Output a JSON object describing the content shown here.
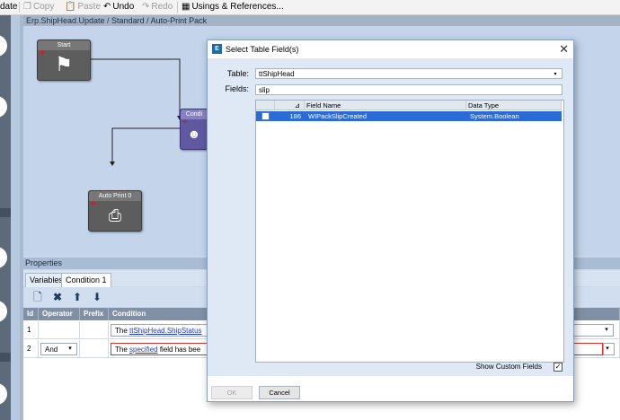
{
  "toolbar": {
    "items": [
      {
        "label": "date",
        "icon": "",
        "enabled": true
      },
      {
        "label": "Copy",
        "icon": "copy-icon",
        "enabled": false
      },
      {
        "label": "Paste",
        "icon": "paste-icon",
        "enabled": false
      },
      {
        "label": "Undo",
        "icon": "undo-icon",
        "enabled": true
      },
      {
        "label": "Redo",
        "icon": "redo-icon",
        "enabled": false
      },
      {
        "label": "Usings & References...",
        "icon": "references-icon",
        "enabled": true
      }
    ]
  },
  "canvas": {
    "title": "Erp.ShipHead.Update / Standard / Auto-Print Pack",
    "nodes": {
      "start": {
        "title": "Start",
        "icon": "flag-icon"
      },
      "condition": {
        "title": "Condi",
        "icon": "person-icon"
      },
      "auto_print": {
        "title": "Auto Print 0",
        "icon": "printer-icon"
      }
    }
  },
  "properties": {
    "title": "Properties",
    "tabs": [
      "Variables",
      "Condition 1"
    ],
    "active_tab": "Condition 1",
    "toolbar_icons": [
      "new-icon",
      "delete-icon",
      "move-up-icon",
      "move-down-icon"
    ],
    "columns": [
      "Id",
      "Operator",
      "Prefix",
      "Condition"
    ],
    "rows": [
      {
        "id": "1",
        "operator": "",
        "prefix": "",
        "condition_pre": "The ",
        "condition_link": "ttShipHead.ShipStatus",
        "condition_post": ""
      },
      {
        "id": "2",
        "operator": "And",
        "prefix": "",
        "condition_pre": "The ",
        "condition_link": "specified",
        "condition_post": " field has bee"
      }
    ]
  },
  "dialog": {
    "title": "Select Table Field(s)",
    "table_label": "Table:",
    "table_value": "ttShipHead",
    "fields_label": "Fields:",
    "fields_value": "slip",
    "columns": [
      "Field Name",
      "Data Type"
    ],
    "rows": [
      {
        "selected": true,
        "number": "186",
        "field_name": "WIPackSlipCreated",
        "data_type": "System.Boolean"
      }
    ],
    "show_custom_label": "Show Custom Fields",
    "show_custom_checked": true,
    "ok_label": "OK",
    "cancel_label": "Cancel",
    "ok_enabled": false
  }
}
